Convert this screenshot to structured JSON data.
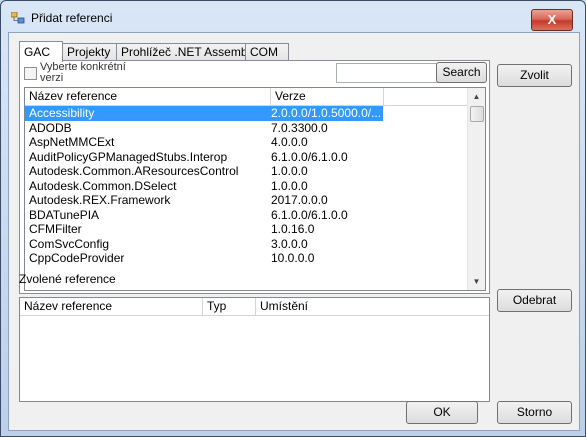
{
  "window": {
    "title": "Přidat referenci",
    "close_label": "X"
  },
  "tabs": [
    "GAC",
    "Projekty",
    "Prohlížeč .NET Assembly",
    "COM"
  ],
  "filter": {
    "checkbox_label": "Vyberte konkrétní verzi",
    "search_value": "",
    "search_button": "Search"
  },
  "list": {
    "columns": [
      "Název reference",
      "Verze"
    ],
    "rows": [
      [
        "Accessibility",
        "2.0.0.0/1.0.5000.0/..."
      ],
      [
        "ADODB",
        "7.0.3300.0"
      ],
      [
        "AspNetMMCExt",
        "4.0.0.0"
      ],
      [
        "AuditPolicyGPManagedStubs.Interop",
        "6.1.0.0/6.1.0.0"
      ],
      [
        "Autodesk.Common.AResourcesControl",
        "1.0.0.0"
      ],
      [
        "Autodesk.Common.DSelect",
        "1.0.0.0"
      ],
      [
        "Autodesk.REX.Framework",
        "2017.0.0.0"
      ],
      [
        "BDATunePIA",
        "6.1.0.0/6.1.0.0"
      ],
      [
        "CFMFilter",
        "1.0.16.0"
      ],
      [
        "ComSvcConfig",
        "3.0.0.0"
      ],
      [
        "CppCodeProvider",
        "10.0.0.0"
      ]
    ],
    "selected_index": 0
  },
  "buttons": {
    "choose": "Zvolit",
    "remove": "Odebrat",
    "ok": "OK",
    "cancel": "Storno"
  },
  "selected_section": {
    "label": "Zvolené reference",
    "columns": [
      "Název reference",
      "Typ",
      "Umístění"
    ]
  }
}
